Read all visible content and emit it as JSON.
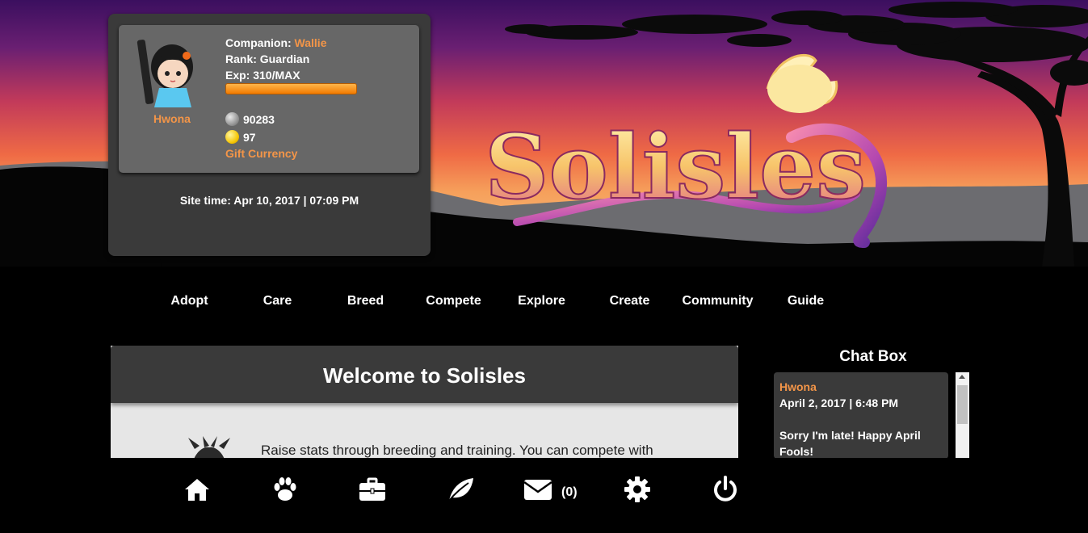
{
  "banner": {
    "logo_text": "Solisles"
  },
  "profile": {
    "companion_label": "Companion:",
    "companion_name": "Wallie",
    "rank": "Rank: Guardian",
    "exp": "Exp: 310/MAX",
    "exp_fraction": 1.0,
    "username": "Hwona",
    "silver": "90283",
    "gold": "97",
    "gift_currency": "Gift Currency",
    "site_time": "Site time: Apr 10, 2017 | 07:09 PM"
  },
  "nav": {
    "items": [
      "Adopt",
      "Care",
      "Breed",
      "Compete",
      "Explore",
      "Create",
      "Community",
      "Guide"
    ]
  },
  "welcome": {
    "title": "Welcome to Solisles",
    "text": "Raise stats through breeding and training. You can compete with"
  },
  "chat": {
    "title": "Chat Box",
    "user": "Hwona",
    "date": "April 2, 2017 | 6:48 PM",
    "message": "Sorry I'm late! Happy April Fools!"
  },
  "bottom_bar": {
    "mail_count": "(0)",
    "icons": [
      "home-icon",
      "paw-icon",
      "briefcase-icon",
      "leaf-icon",
      "mail-icon",
      "gear-icon",
      "power-icon"
    ]
  },
  "colors": {
    "accent": "#f39548",
    "panel": "#3a3a3a",
    "card": "#676767"
  }
}
